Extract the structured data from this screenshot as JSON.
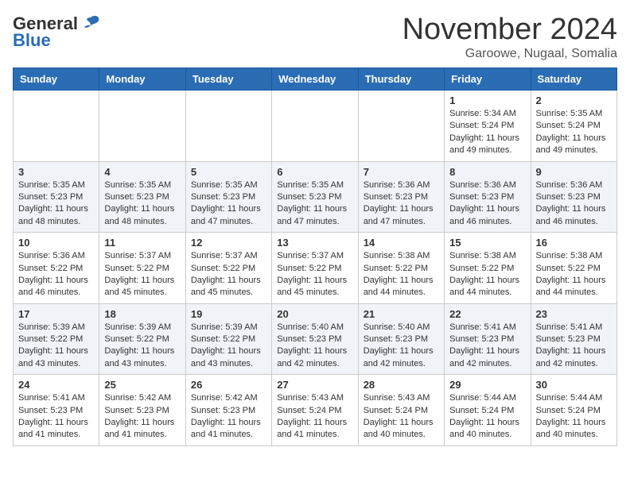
{
  "header": {
    "logo_general": "General",
    "logo_blue": "Blue",
    "month": "November 2024",
    "location": "Garoowe, Nugaal, Somalia"
  },
  "days_of_week": [
    "Sunday",
    "Monday",
    "Tuesday",
    "Wednesday",
    "Thursday",
    "Friday",
    "Saturday"
  ],
  "weeks": [
    [
      {
        "day": "",
        "info": ""
      },
      {
        "day": "",
        "info": ""
      },
      {
        "day": "",
        "info": ""
      },
      {
        "day": "",
        "info": ""
      },
      {
        "day": "",
        "info": ""
      },
      {
        "day": "1",
        "info": "Sunrise: 5:34 AM\nSunset: 5:24 PM\nDaylight: 11 hours\nand 49 minutes."
      },
      {
        "day": "2",
        "info": "Sunrise: 5:35 AM\nSunset: 5:24 PM\nDaylight: 11 hours\nand 49 minutes."
      }
    ],
    [
      {
        "day": "3",
        "info": "Sunrise: 5:35 AM\nSunset: 5:23 PM\nDaylight: 11 hours\nand 48 minutes."
      },
      {
        "day": "4",
        "info": "Sunrise: 5:35 AM\nSunset: 5:23 PM\nDaylight: 11 hours\nand 48 minutes."
      },
      {
        "day": "5",
        "info": "Sunrise: 5:35 AM\nSunset: 5:23 PM\nDaylight: 11 hours\nand 47 minutes."
      },
      {
        "day": "6",
        "info": "Sunrise: 5:35 AM\nSunset: 5:23 PM\nDaylight: 11 hours\nand 47 minutes."
      },
      {
        "day": "7",
        "info": "Sunrise: 5:36 AM\nSunset: 5:23 PM\nDaylight: 11 hours\nand 47 minutes."
      },
      {
        "day": "8",
        "info": "Sunrise: 5:36 AM\nSunset: 5:23 PM\nDaylight: 11 hours\nand 46 minutes."
      },
      {
        "day": "9",
        "info": "Sunrise: 5:36 AM\nSunset: 5:23 PM\nDaylight: 11 hours\nand 46 minutes."
      }
    ],
    [
      {
        "day": "10",
        "info": "Sunrise: 5:36 AM\nSunset: 5:22 PM\nDaylight: 11 hours\nand 46 minutes."
      },
      {
        "day": "11",
        "info": "Sunrise: 5:37 AM\nSunset: 5:22 PM\nDaylight: 11 hours\nand 45 minutes."
      },
      {
        "day": "12",
        "info": "Sunrise: 5:37 AM\nSunset: 5:22 PM\nDaylight: 11 hours\nand 45 minutes."
      },
      {
        "day": "13",
        "info": "Sunrise: 5:37 AM\nSunset: 5:22 PM\nDaylight: 11 hours\nand 45 minutes."
      },
      {
        "day": "14",
        "info": "Sunrise: 5:38 AM\nSunset: 5:22 PM\nDaylight: 11 hours\nand 44 minutes."
      },
      {
        "day": "15",
        "info": "Sunrise: 5:38 AM\nSunset: 5:22 PM\nDaylight: 11 hours\nand 44 minutes."
      },
      {
        "day": "16",
        "info": "Sunrise: 5:38 AM\nSunset: 5:22 PM\nDaylight: 11 hours\nand 44 minutes."
      }
    ],
    [
      {
        "day": "17",
        "info": "Sunrise: 5:39 AM\nSunset: 5:22 PM\nDaylight: 11 hours\nand 43 minutes."
      },
      {
        "day": "18",
        "info": "Sunrise: 5:39 AM\nSunset: 5:22 PM\nDaylight: 11 hours\nand 43 minutes."
      },
      {
        "day": "19",
        "info": "Sunrise: 5:39 AM\nSunset: 5:22 PM\nDaylight: 11 hours\nand 43 minutes."
      },
      {
        "day": "20",
        "info": "Sunrise: 5:40 AM\nSunset: 5:23 PM\nDaylight: 11 hours\nand 42 minutes."
      },
      {
        "day": "21",
        "info": "Sunrise: 5:40 AM\nSunset: 5:23 PM\nDaylight: 11 hours\nand 42 minutes."
      },
      {
        "day": "22",
        "info": "Sunrise: 5:41 AM\nSunset: 5:23 PM\nDaylight: 11 hours\nand 42 minutes."
      },
      {
        "day": "23",
        "info": "Sunrise: 5:41 AM\nSunset: 5:23 PM\nDaylight: 11 hours\nand 42 minutes."
      }
    ],
    [
      {
        "day": "24",
        "info": "Sunrise: 5:41 AM\nSunset: 5:23 PM\nDaylight: 11 hours\nand 41 minutes."
      },
      {
        "day": "25",
        "info": "Sunrise: 5:42 AM\nSunset: 5:23 PM\nDaylight: 11 hours\nand 41 minutes."
      },
      {
        "day": "26",
        "info": "Sunrise: 5:42 AM\nSunset: 5:23 PM\nDaylight: 11 hours\nand 41 minutes."
      },
      {
        "day": "27",
        "info": "Sunrise: 5:43 AM\nSunset: 5:24 PM\nDaylight: 11 hours\nand 41 minutes."
      },
      {
        "day": "28",
        "info": "Sunrise: 5:43 AM\nSunset: 5:24 PM\nDaylight: 11 hours\nand 40 minutes."
      },
      {
        "day": "29",
        "info": "Sunrise: 5:44 AM\nSunset: 5:24 PM\nDaylight: 11 hours\nand 40 minutes."
      },
      {
        "day": "30",
        "info": "Sunrise: 5:44 AM\nSunset: 5:24 PM\nDaylight: 11 hours\nand 40 minutes."
      }
    ]
  ]
}
